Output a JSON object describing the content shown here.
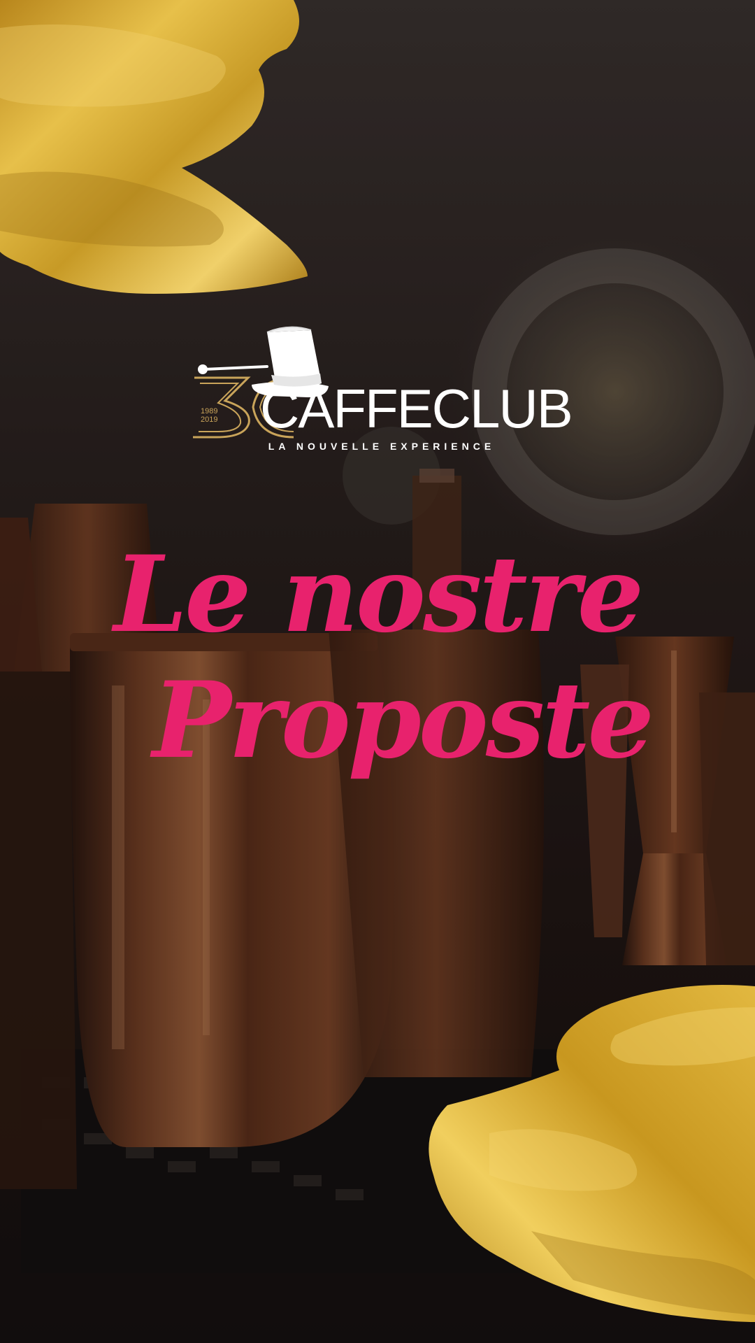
{
  "brand": {
    "name": "CAFFECLUB",
    "anniversary_number": "30",
    "years_start": "1989",
    "years_end": "2019",
    "tagline": "LA NOUVELLE EXPERIENCE"
  },
  "headline": {
    "line1": "Le nostre",
    "line2": "Proposte"
  },
  "colors": {
    "headline": "#e8226d",
    "gold": "#d4a62a",
    "logo_gold": "#c9a45a",
    "background": "#1e1614"
  },
  "icons": [
    "top-hat-icon",
    "cane-icon"
  ]
}
